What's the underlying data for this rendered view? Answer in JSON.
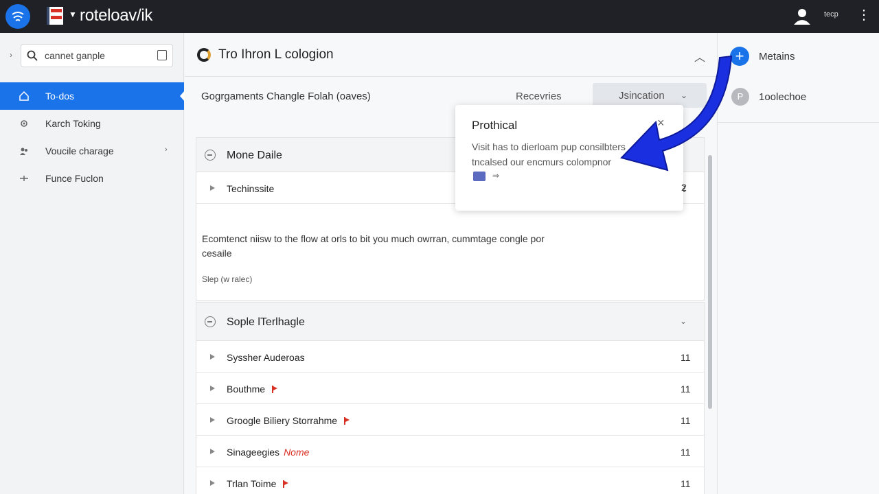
{
  "topbar": {
    "brand": "roteloav/ik",
    "user_label": "tecp"
  },
  "sidebar": {
    "search": {
      "value": "cannet ganple",
      "placeholder": "cannet ganple"
    },
    "items": [
      {
        "label": "To-dos",
        "icon": "home-icon"
      },
      {
        "label": "Karch Toking",
        "icon": "gear-icon"
      },
      {
        "label": "Voucile charage",
        "icon": "people-icon"
      },
      {
        "label": "Funce Fuclon",
        "icon": "connect-icon"
      }
    ]
  },
  "main": {
    "title": "Tro Ihron L cologion",
    "subheader": {
      "title": "Gogrgaments Changle Folah (oaves)",
      "receivers": "Recevries",
      "dropdown": "Jsincation"
    },
    "section1": {
      "title": "Mone Daile",
      "rows": [
        {
          "label": "Techinssite",
          "count": "2"
        }
      ]
    },
    "description": {
      "text": "Ecomtenct niisw to the flow at orls to bit you much owrran, cummtage congle por cesaile",
      "note": "Slep (w ralec)"
    },
    "section2": {
      "title": "Sople lTerlhagle",
      "rows": [
        {
          "label": "Syssher Auderoas",
          "count": "11",
          "tag": ""
        },
        {
          "label": "Bouthme",
          "count": "11",
          "tag": ""
        },
        {
          "label": "Groogle Biliery Storrahme",
          "count": "11",
          "tag": ""
        },
        {
          "label": "Sinageegies",
          "count": "11",
          "tag": "Nome"
        },
        {
          "label": "Trlan Toime",
          "count": "11",
          "tag": ""
        }
      ]
    }
  },
  "popover": {
    "title": "Prothical",
    "body": "Visit has to dierloam pup consilbters tncalsed our encmurs colompnor",
    "close": "×",
    "chip_arrow": "⇒"
  },
  "right": {
    "item1": "Metains",
    "avatar": "P",
    "item2": "1oolechoe"
  },
  "colors": {
    "accent": "#1a73e8",
    "topbar": "#1f2126",
    "tag": "#d93025"
  }
}
